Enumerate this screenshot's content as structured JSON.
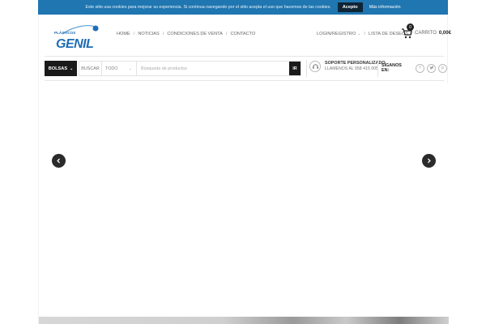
{
  "cookie_bar": {
    "text": "Este sitio usa cookies para mejorar su experiencia. Si continua navegando por el sitio acepta el uso que hacemos de las cookies.",
    "accept_label": "Acepto",
    "more_label": "Más información"
  },
  "logo": {
    "small_text": "PLÁSTICOS",
    "big_text": "GENIL"
  },
  "nav": {
    "items": [
      {
        "label": "HOME"
      },
      {
        "label": "NOTICIAS"
      },
      {
        "label": "CONDICIONES DE VENTA"
      },
      {
        "label": "CONTACTO"
      }
    ]
  },
  "user_links": {
    "login": "LOGIN/REGISTRO",
    "wishlist": "LISTA DE DESEOS"
  },
  "cart": {
    "count": "0",
    "label": "CARRITO",
    "total": "0,00€"
  },
  "search_bar": {
    "category_button": "BOLSAS",
    "label": "BUSCAR",
    "select_value": "TODO",
    "placeholder": "Búsqueda de productos",
    "submit": "IR"
  },
  "support": {
    "title": "SOPORTE PERSONALIZADO",
    "phone": "LLAMENOS AL 958 415 005"
  },
  "social": {
    "label": "SÍGANOS EN:",
    "icons": [
      "facebook-icon",
      "twitter-icon",
      "pinterest-icon"
    ]
  },
  "colors": {
    "cookie_bar": "#1f76b0",
    "brand_blue": "#1f6db5",
    "dark": "#1a1a1a"
  }
}
